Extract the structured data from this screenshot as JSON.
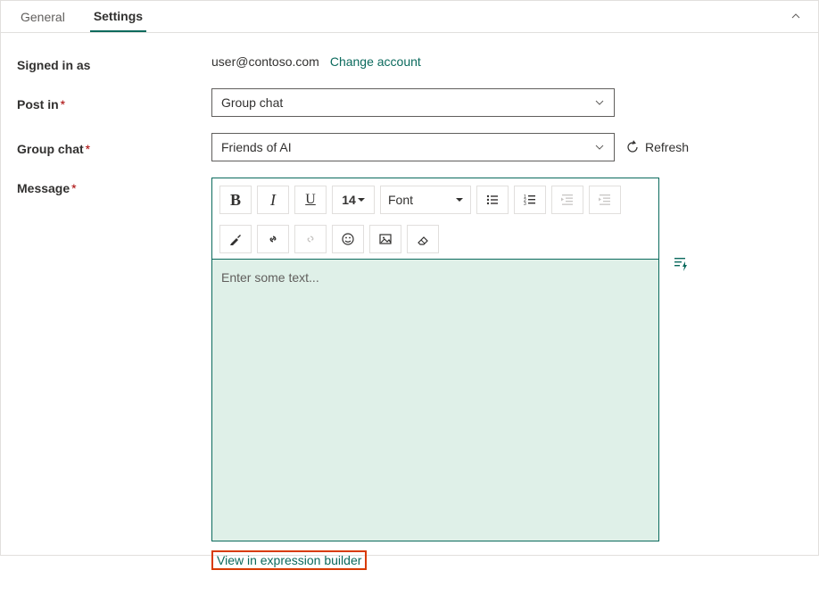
{
  "tabs": {
    "general": "General",
    "settings": "Settings"
  },
  "fields": {
    "signed_in_label": "Signed in as",
    "signed_in_email": "user@contoso.com",
    "change_account": "Change account",
    "post_in_label": "Post in",
    "post_in_value": "Group chat",
    "group_chat_label": "Group chat",
    "group_chat_value": "Friends of AI",
    "refresh": "Refresh",
    "message_label": "Message"
  },
  "editor": {
    "font_size": "14",
    "font_label": "Font",
    "placeholder": "Enter some text..."
  },
  "footer": {
    "view_builder": "View in expression builder"
  }
}
